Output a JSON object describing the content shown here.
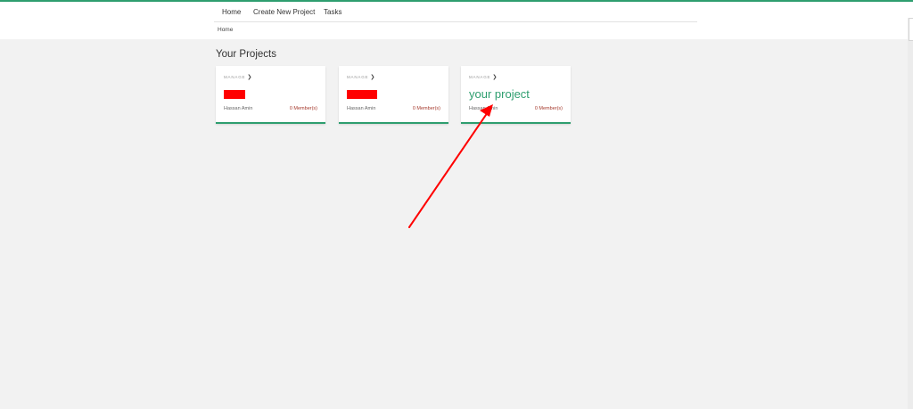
{
  "nav": {
    "items": [
      "Home",
      "Create New Project",
      "Tasks"
    ]
  },
  "breadcrumb": "Home",
  "section_title": "Your Projects",
  "projects": [
    {
      "manage_label": "MANAGE",
      "name": "",
      "owner": "Hassan Amin",
      "members": "0 Member(s)"
    },
    {
      "manage_label": "MANAGE",
      "name": "",
      "owner": "Hassan Amin",
      "members": "0 Member(s)"
    },
    {
      "manage_label": "MANAGE",
      "name": "your project",
      "owner": "Hassan Amin",
      "members": "0 Member(s)"
    }
  ],
  "colors": {
    "accent": "#2e9e6f",
    "redaction": "#ff0000",
    "annotation_arrow": "#ff0000",
    "members_text": "#a5392c"
  },
  "icons": {
    "manage_chevron": "chevron-right-icon"
  }
}
